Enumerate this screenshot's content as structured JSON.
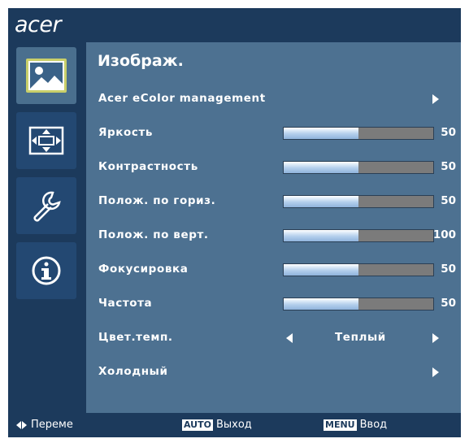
{
  "logo": "acer",
  "sidebar": {
    "items": [
      {
        "icon": "image-icon",
        "active": true
      },
      {
        "icon": "position-icon",
        "active": false
      },
      {
        "icon": "settings-icon",
        "active": false
      },
      {
        "icon": "info-icon",
        "active": false
      }
    ]
  },
  "panel": {
    "title": "Изображ.",
    "rows": [
      {
        "label": "Acer eColor management",
        "type": "submenu"
      },
      {
        "label": "Яркость",
        "type": "slider",
        "value": "50",
        "fraction": 0.5
      },
      {
        "label": "Контрастность",
        "type": "slider",
        "value": "50",
        "fraction": 0.5
      },
      {
        "label": "Полож. по гориз.",
        "type": "slider",
        "value": "50",
        "fraction": 0.5
      },
      {
        "label": "Полож. по верт.",
        "type": "slider",
        "value": "100",
        "fraction": 0.5
      },
      {
        "label": "Фокусировка",
        "type": "slider",
        "value": "50",
        "fraction": 0.5
      },
      {
        "label": "Частота",
        "type": "slider",
        "value": "50",
        "fraction": 0.5
      },
      {
        "label": "Цвет.темп.",
        "type": "choice",
        "value": "Теплый"
      },
      {
        "label": "Холодный",
        "type": "submenu"
      }
    ]
  },
  "footer": {
    "move_label": "Переме",
    "auto_key": "AUTO",
    "auto_label": "Выход",
    "menu_key": "MENU",
    "menu_label": "Ввод"
  },
  "colors": {
    "background": "#1c3a5c",
    "panel": "#4d7191",
    "active_tab": "#4a6f8e",
    "slider_track": "#7b7b7b",
    "slider_fill": "#b4cfec"
  }
}
